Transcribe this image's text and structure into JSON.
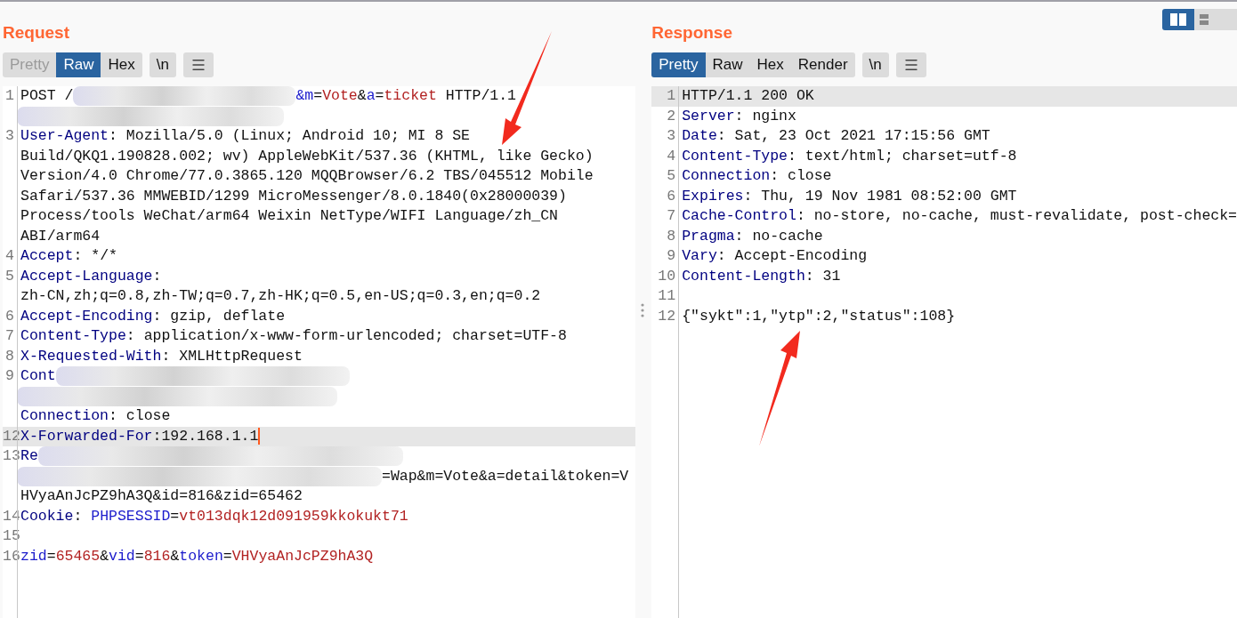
{
  "request": {
    "title": "Request",
    "tabs": [
      {
        "label": "Pretty",
        "selected": false,
        "disabled": true
      },
      {
        "label": "Raw",
        "selected": true,
        "disabled": false
      },
      {
        "label": "Hex",
        "selected": false,
        "disabled": false
      }
    ],
    "newline_button": "\\n",
    "lines": [
      {
        "number": "1",
        "highlighted": false,
        "cursor": false,
        "segments": [
          {
            "kind": "text",
            "text": "POST /"
          },
          {
            "kind": "redact"
          },
          {
            "kind": "param",
            "text": "&m"
          },
          {
            "kind": "text",
            "text": "="
          },
          {
            "kind": "value",
            "text": "Vote"
          },
          {
            "kind": "text",
            "text": "&"
          },
          {
            "kind": "param",
            "text": "a"
          },
          {
            "kind": "text",
            "text": "="
          },
          {
            "kind": "value",
            "text": "ticket"
          },
          {
            "kind": "text",
            "text": " HTTP/1.1"
          }
        ]
      },
      {
        "highlighted": false,
        "cursor": false,
        "segments": [
          {
            "kind": "redact"
          }
        ]
      },
      {
        "number": "3",
        "highlighted": false,
        "cursor": false,
        "segments": [
          {
            "kind": "key",
            "text": "User-Agent"
          },
          {
            "kind": "text",
            "text": ": Mozilla/5.0 (Linux; Android 10; MI 8 SE"
          }
        ]
      },
      {
        "highlighted": false,
        "cursor": false,
        "segments": [
          {
            "kind": "text",
            "text": "Build/QKQ1.190828.002; wv) AppleWebKit/537.36 (KHTML, like Gecko)"
          }
        ]
      },
      {
        "highlighted": false,
        "cursor": false,
        "segments": [
          {
            "kind": "text",
            "text": "Version/4.0 Chrome/77.0.3865.120 MQQBrowser/6.2 TBS/045512 Mobile"
          }
        ]
      },
      {
        "highlighted": false,
        "cursor": false,
        "segments": [
          {
            "kind": "text",
            "text": "Safari/537.36 MMWEBID/1299 MicroMessenger/8.0.1840(0x28000039)"
          }
        ]
      },
      {
        "highlighted": false,
        "cursor": false,
        "segments": [
          {
            "kind": "text",
            "text": "Process/tools WeChat/arm64 Weixin NetType/WIFI Language/zh_CN"
          }
        ]
      },
      {
        "highlighted": false,
        "cursor": false,
        "segments": [
          {
            "kind": "text",
            "text": "ABI/arm64"
          }
        ]
      },
      {
        "number": "4",
        "highlighted": false,
        "cursor": false,
        "segments": [
          {
            "kind": "key",
            "text": "Accept"
          },
          {
            "kind": "text",
            "text": ": */*"
          }
        ]
      },
      {
        "number": "5",
        "highlighted": false,
        "cursor": false,
        "segments": [
          {
            "kind": "key",
            "text": "Accept-Language"
          },
          {
            "kind": "text",
            "text": ":"
          }
        ]
      },
      {
        "highlighted": false,
        "cursor": false,
        "segments": [
          {
            "kind": "text",
            "text": "zh-CN,zh;q=0.8,zh-TW;q=0.7,zh-HK;q=0.5,en-US;q=0.3,en;q=0.2"
          }
        ]
      },
      {
        "number": "6",
        "highlighted": false,
        "cursor": false,
        "segments": [
          {
            "kind": "key",
            "text": "Accept-Encoding"
          },
          {
            "kind": "text",
            "text": ": gzip, deflate"
          }
        ]
      },
      {
        "number": "7",
        "highlighted": false,
        "cursor": false,
        "segments": [
          {
            "kind": "key",
            "text": "Content-Type"
          },
          {
            "kind": "text",
            "text": ": application/x-www-form-urlencoded; charset=UTF-8"
          }
        ]
      },
      {
        "number": "8",
        "highlighted": false,
        "cursor": false,
        "segments": [
          {
            "kind": "key",
            "text": "X-Requested-With"
          },
          {
            "kind": "text",
            "text": ": XMLHttpRequest"
          }
        ]
      },
      {
        "number": "9",
        "highlighted": false,
        "cursor": false,
        "segments": [
          {
            "kind": "key",
            "text": "Cont"
          },
          {
            "kind": "redact"
          }
        ]
      },
      {
        "highlighted": false,
        "cursor": false,
        "segments": [
          {
            "kind": "redact"
          }
        ]
      },
      {
        "highlighted": false,
        "cursor": false,
        "segments": [
          {
            "kind": "key",
            "text": "Connection"
          },
          {
            "kind": "text",
            "text": ": close"
          }
        ]
      },
      {
        "number": "12",
        "highlighted": true,
        "cursor": true,
        "segments": [
          {
            "kind": "key",
            "text": "X-Forwarded-For"
          },
          {
            "kind": "text",
            "text": ":192.168.1.1"
          }
        ]
      },
      {
        "number": "13",
        "highlighted": false,
        "cursor": false,
        "segments": [
          {
            "kind": "key",
            "text": "Re"
          },
          {
            "kind": "redact"
          }
        ]
      },
      {
        "highlighted": false,
        "cursor": false,
        "segments": [
          {
            "kind": "redact"
          },
          {
            "kind": "text",
            "text": "=Wap&m=Vote&a=detail&token=V"
          }
        ]
      },
      {
        "highlighted": false,
        "cursor": false,
        "segments": [
          {
            "kind": "text",
            "text": "HVyaAnJcPZ9hA3Q&id=816&zid=65462"
          }
        ]
      },
      {
        "number": "14",
        "highlighted": false,
        "cursor": false,
        "segments": [
          {
            "kind": "key",
            "text": "Cookie"
          },
          {
            "kind": "text",
            "text": ": "
          },
          {
            "kind": "param",
            "text": "PHPSESSID"
          },
          {
            "kind": "text",
            "text": "="
          },
          {
            "kind": "value",
            "text": "vt013dqk12d091959kkokukt71"
          }
        ]
      },
      {
        "number": "15",
        "highlighted": false,
        "cursor": false
      },
      {
        "number": "16",
        "highlighted": false,
        "cursor": false,
        "segments": [
          {
            "kind": "param",
            "text": "zid"
          },
          {
            "kind": "text",
            "text": "="
          },
          {
            "kind": "value",
            "text": "65465"
          },
          {
            "kind": "text",
            "text": "&"
          },
          {
            "kind": "param",
            "text": "vid"
          },
          {
            "kind": "text",
            "text": "="
          },
          {
            "kind": "value",
            "text": "816"
          },
          {
            "kind": "text",
            "text": "&"
          },
          {
            "kind": "param",
            "text": "token"
          },
          {
            "kind": "text",
            "text": "="
          },
          {
            "kind": "value",
            "text": "VHVyaAnJcPZ9hA3Q"
          }
        ]
      }
    ]
  },
  "response": {
    "title": "Response",
    "tabs": [
      {
        "label": "Pretty",
        "selected": true,
        "disabled": false
      },
      {
        "label": "Raw",
        "selected": false,
        "disabled": false
      },
      {
        "label": "Hex",
        "selected": false,
        "disabled": false
      },
      {
        "label": "Render",
        "selected": false,
        "disabled": false
      }
    ],
    "newline_button": "\\n",
    "lines": [
      {
        "number": "1",
        "highlighted": true,
        "cursor": false,
        "segments": [
          {
            "kind": "text",
            "text": "HTTP/1.1 200 OK"
          }
        ]
      },
      {
        "number": "2",
        "highlighted": false,
        "cursor": false,
        "segments": [
          {
            "kind": "key",
            "text": "Server"
          },
          {
            "kind": "text",
            "text": ": nginx"
          }
        ]
      },
      {
        "number": "3",
        "highlighted": false,
        "cursor": false,
        "segments": [
          {
            "kind": "key",
            "text": "Date"
          },
          {
            "kind": "text",
            "text": ": Sat, 23 Oct 2021 17:15:56 GMT"
          }
        ]
      },
      {
        "number": "4",
        "highlighted": false,
        "cursor": false,
        "segments": [
          {
            "kind": "key",
            "text": "Content-Type"
          },
          {
            "kind": "text",
            "text": ": text/html; charset=utf-8"
          }
        ]
      },
      {
        "number": "5",
        "highlighted": false,
        "cursor": false,
        "segments": [
          {
            "kind": "key",
            "text": "Connection"
          },
          {
            "kind": "text",
            "text": ": close"
          }
        ]
      },
      {
        "number": "6",
        "highlighted": false,
        "cursor": false,
        "segments": [
          {
            "kind": "key",
            "text": "Expires"
          },
          {
            "kind": "text",
            "text": ": Thu, 19 Nov 1981 08:52:00 GMT"
          }
        ]
      },
      {
        "number": "7",
        "highlighted": false,
        "cursor": false,
        "segments": [
          {
            "kind": "key",
            "text": "Cache-Control"
          },
          {
            "kind": "text",
            "text": ": no-store, no-cache, must-revalidate, post-check="
          }
        ]
      },
      {
        "number": "8",
        "highlighted": false,
        "cursor": false,
        "segments": [
          {
            "kind": "key",
            "text": "Pragma"
          },
          {
            "kind": "text",
            "text": ": no-cache"
          }
        ]
      },
      {
        "number": "9",
        "highlighted": false,
        "cursor": false,
        "segments": [
          {
            "kind": "key",
            "text": "Vary"
          },
          {
            "kind": "text",
            "text": ": Accept-Encoding"
          }
        ]
      },
      {
        "number": "10",
        "highlighted": false,
        "cursor": false,
        "segments": [
          {
            "kind": "key",
            "text": "Content-Length"
          },
          {
            "kind": "text",
            "text": ": 31"
          }
        ]
      },
      {
        "number": "11",
        "highlighted": false,
        "cursor": false
      },
      {
        "number": "12",
        "highlighted": false,
        "cursor": false,
        "segments": [
          {
            "kind": "text",
            "text": "{\"sykt\":1,\"ytp\":2,\"status\":108}"
          }
        ]
      }
    ]
  }
}
